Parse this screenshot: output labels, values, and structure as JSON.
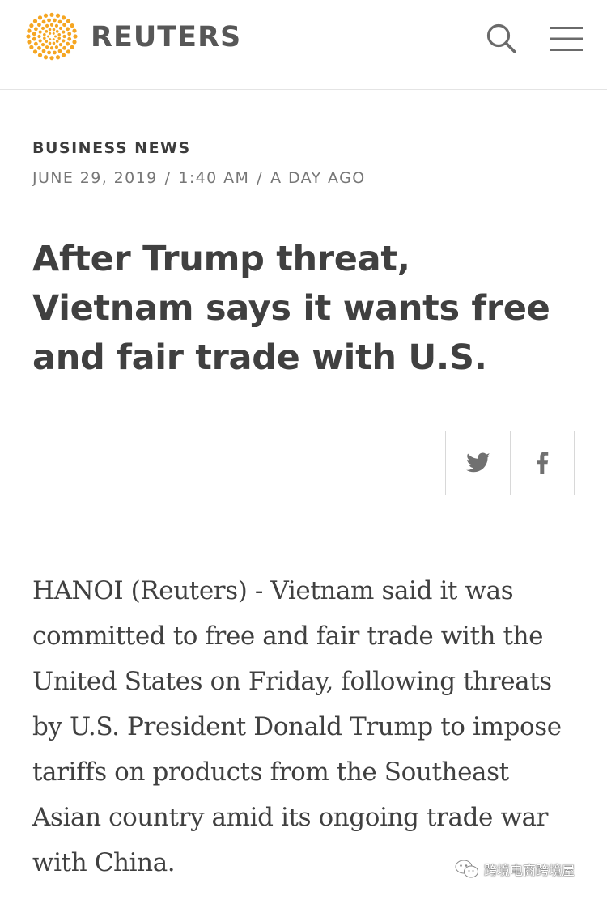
{
  "header": {
    "brand": "REUTERS",
    "logo_icon": "reuters-dots-logo",
    "search_icon": "search-icon",
    "menu_icon": "hamburger-menu-icon",
    "logo_color": "#f5a623"
  },
  "article": {
    "section": "BUSINESS NEWS",
    "date": "JUNE 29, 2019",
    "separator": "/",
    "time": "1:40 AM",
    "relative": "A DAY AGO",
    "headline": "After Trump threat, Vietnam says it wants free and fair trade with U.S.",
    "body": "HANOI (Reuters) - Vietnam said it was committed to free and fair trade with the United States on Friday, following threats by U.S. President Donald Trump to impose tariffs on products from the Southeast Asian country amid its ongoing trade war with China."
  },
  "share": {
    "twitter_icon": "twitter-icon",
    "facebook_icon": "facebook-icon"
  },
  "watermark": {
    "text": "跨境电商跨境屋",
    "icon": "wechat-icon"
  }
}
